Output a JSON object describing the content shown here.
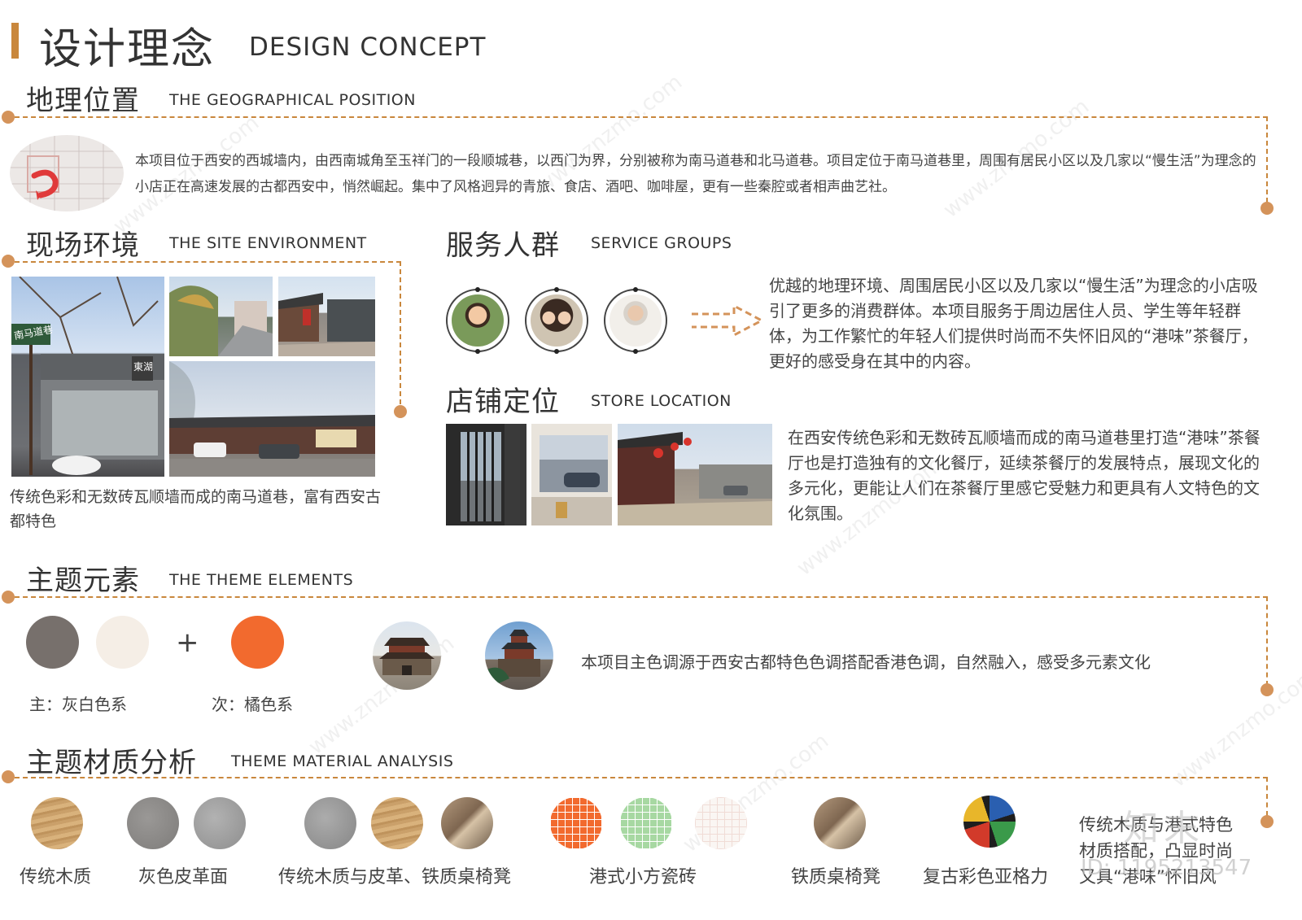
{
  "header": {
    "title_cn": "设计理念",
    "title_en": "DESIGN CONCEPT"
  },
  "geo": {
    "title_cn": "地理位置",
    "title_en": "THE GEOGRAPHICAL POSITION",
    "text": "本项目位于西安的西城墙内，由西南城角至玉祥门的一段顺城巷，以西门为界，分别被称为南马道巷和北马道巷。项目定位于南马道巷里，周围有居民小区以及几家以“慢生活”为理念的小店正在高速发展的古都西安中，悄然崛起。集中了风格迥异的青旅、食店、酒吧、咖啡屋，更有一些秦腔或者相声曲艺社。"
  },
  "site": {
    "title_cn": "现场环境",
    "title_en": "THE SITE ENVIRONMENT",
    "sign_text": "南马道巷",
    "shop_sign": "東湖",
    "caption": "传统色彩和无数砖瓦顺墙而成的南马道巷，富有西安古都特色"
  },
  "service": {
    "title_cn": "服务人群",
    "title_en": "SERVICE GROUPS",
    "text": "优越的地理环境、周围居民小区以及几家以“慢生活”为理念的小店吸引了更多的消费群体。本项目服务于周边居住人员、学生等年轻群体，为工作繁忙的年轻人们提供时尚而不失怀旧风的“港味”茶餐厅，更好的感受身在其中的内容。"
  },
  "store": {
    "title_cn": "店铺定位",
    "title_en": "STORE LOCATION",
    "text": "在西安传统色彩和无数砖瓦顺墙而成的南马道巷里打造“港味”茶餐厅也是打造独有的文化餐厅，延续茶餐厅的发展特点，展现文化的多元化，更能让人们在茶餐厅里感它受魅力和更具有人文特色的文化氛围。"
  },
  "theme": {
    "title_cn": "主题元素",
    "title_en": "THE THEME ELEMENTS",
    "plus": "+",
    "primary_label": "主：灰白色系",
    "secondary_label": "次：橘色系",
    "text": "本项目主色调源于西安古都特色色调搭配香港色调，自然融入，感受多元素文化",
    "colors": {
      "gray": "#77706c",
      "offwhite": "#f5eee6",
      "orange": "#f26a2e"
    }
  },
  "material": {
    "title_cn": "主题材质分析",
    "title_en": "THEME MATERIAL ANALYSIS",
    "labels": [
      "传统木质",
      "灰色皮革面",
      "传统木质与皮革、铁质桌椅凳",
      "港式小方瓷砖",
      "铁质桌椅凳",
      "复古彩色亚格力"
    ],
    "note_lines": [
      "传统木质与港式特色",
      "材质搭配，凸显时尚",
      "又具“港味”怀旧风"
    ]
  },
  "watermarks": {
    "site": "www.znzmo.com",
    "brand": "知末网",
    "logo": "知末",
    "id": "ID: 1195213547"
  },
  "accent": "#c9873c"
}
